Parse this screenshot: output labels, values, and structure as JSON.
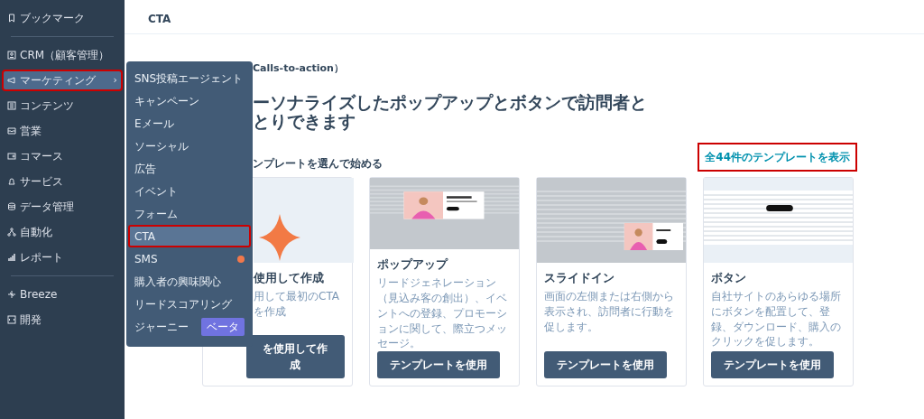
{
  "sidebar": {
    "items": [
      {
        "label": "ブックマーク",
        "selected": false,
        "highlighted": false,
        "divider_after": true
      },
      {
        "label": "CRM（顧客管理）",
        "selected": false,
        "highlighted": false
      },
      {
        "label": "マーケティング",
        "selected": true,
        "highlighted": true,
        "chevron": "›"
      },
      {
        "label": "コンテンツ",
        "selected": false,
        "highlighted": false
      },
      {
        "label": "営業",
        "selected": false,
        "highlighted": false
      },
      {
        "label": "コマース",
        "selected": false,
        "highlighted": false
      },
      {
        "label": "サービス",
        "selected": false,
        "highlighted": false
      },
      {
        "label": "データ管理",
        "selected": false,
        "highlighted": false
      },
      {
        "label": "自動化",
        "selected": false,
        "highlighted": false
      },
      {
        "label": "レポート",
        "selected": false,
        "highlighted": false,
        "divider_after": true
      },
      {
        "label": "Breeze",
        "selected": false,
        "highlighted": false
      },
      {
        "label": "開発",
        "selected": false,
        "highlighted": false
      }
    ]
  },
  "header": {
    "title": "CTA"
  },
  "submenu": {
    "items": [
      {
        "label": "SNS投稿エージェント",
        "selected": false,
        "highlighted": false
      },
      {
        "label": "キャンペーン",
        "selected": false,
        "highlighted": false
      },
      {
        "label": "Eメール",
        "selected": false,
        "highlighted": false
      },
      {
        "label": "ソーシャル",
        "selected": false,
        "highlighted": false
      },
      {
        "label": "広告",
        "selected": false,
        "highlighted": false
      },
      {
        "label": "イベント",
        "selected": false,
        "highlighted": false
      },
      {
        "label": "フォーム",
        "selected": false,
        "highlighted": false
      },
      {
        "label": "CTA",
        "selected": true,
        "highlighted": true
      },
      {
        "label": "SMS",
        "selected": false,
        "highlighted": false,
        "dot": true
      },
      {
        "label": "購入者の興味関心",
        "selected": false,
        "highlighted": false
      },
      {
        "label": "リードスコアリング",
        "selected": false,
        "highlighted": false
      },
      {
        "label": "ジャーニー",
        "selected": false,
        "highlighted": false,
        "badge": "ベータ"
      }
    ]
  },
  "main": {
    "eyebrow": "Calls-to-action）",
    "heading": [
      "ーソナライズしたポップアップとボタンで訪問者と",
      "とりできます"
    ],
    "subheading": "ンプレートを選んで始める",
    "view_all": {
      "label": "全44件のテンプレートを表示",
      "highlighted": true
    }
  },
  "cards": [
    {
      "kind": "sparkle",
      "title": "使用して作成",
      "description": "用して最初のCTAを作成",
      "button": "を使用して作成"
    },
    {
      "kind": "popup",
      "title": "ポップアップ",
      "description": "リードジェネレーション（見込み客の創出）、イベントへの登録、プロモーションに関して、際立つメッセージ。",
      "button": "テンプレートを使用"
    },
    {
      "kind": "slidein",
      "title": "スライドイン",
      "description": "画面の左側または右側から表示され、訪問者に行動を促します。",
      "button": "テンプレートを使用"
    },
    {
      "kind": "button",
      "title": "ボタン",
      "description": "自社サイトのあらゆる場所にボタンを配置して、登録、ダウンロード、購入のクリックを促します。",
      "button": "テンプレートを使用"
    }
  ]
}
